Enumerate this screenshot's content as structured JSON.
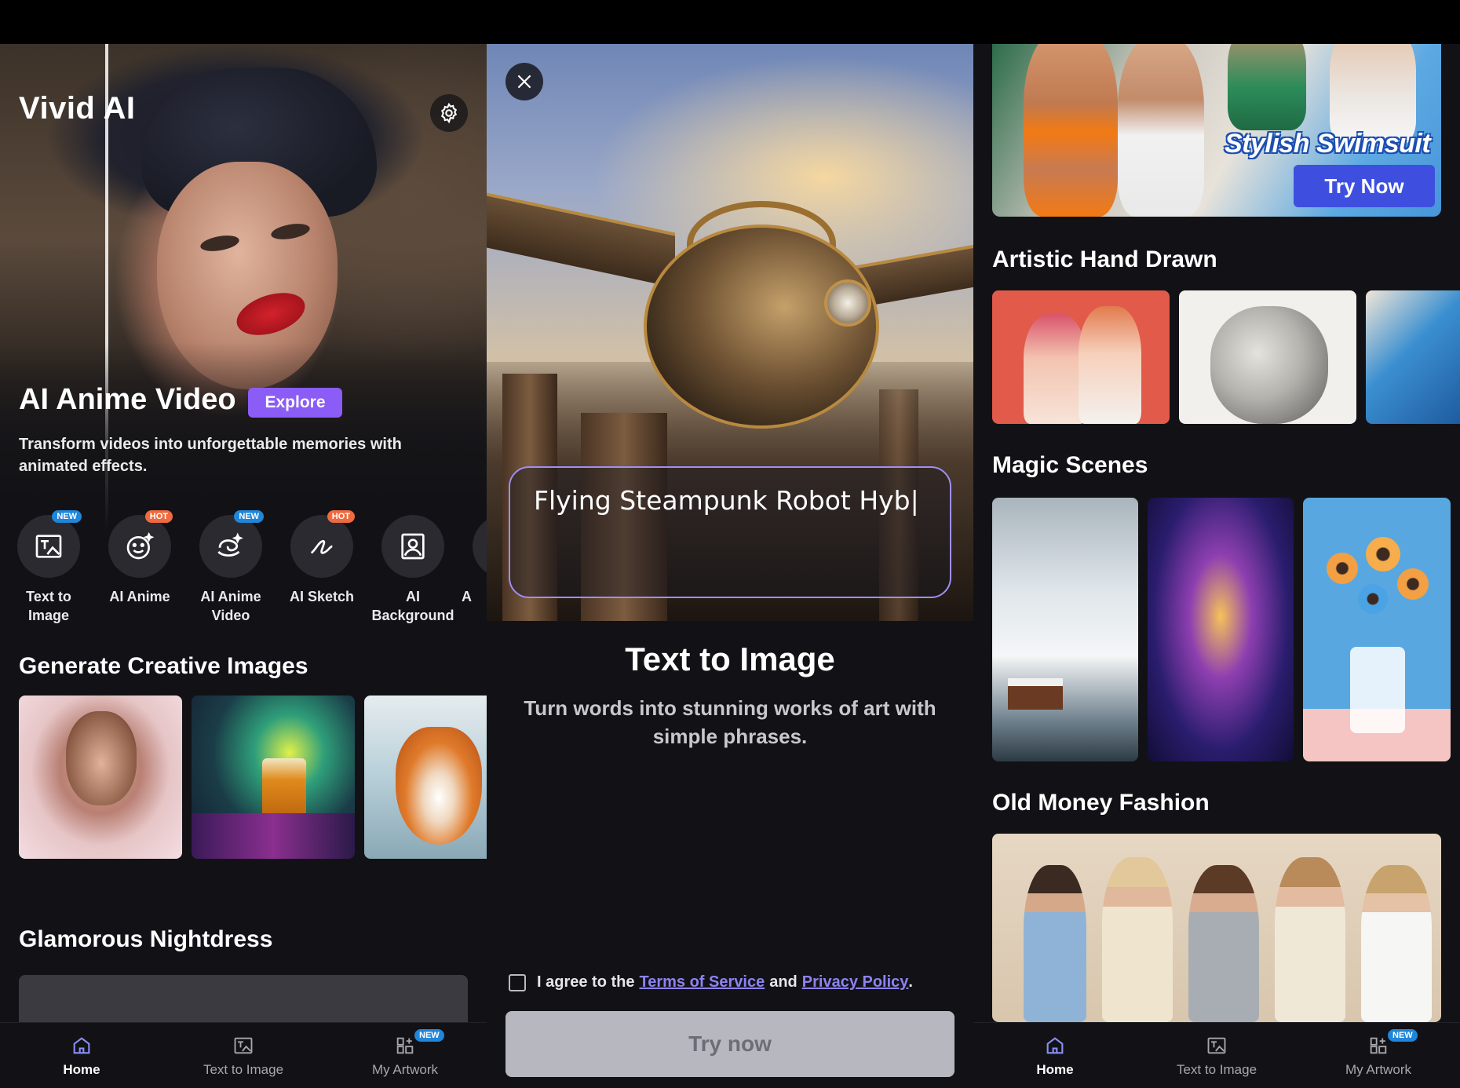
{
  "left": {
    "app_title": "Vivid AI",
    "hero": {
      "title": "AI Anime Video",
      "explore": "Explore",
      "description": "Transform videos into unforgettable memories with animated effects."
    },
    "tools": [
      {
        "label": "Text to\nImage",
        "badge": "NEW",
        "icon": "text-image-icon"
      },
      {
        "label": "AI Anime",
        "badge": "HOT",
        "icon": "smile-face-icon"
      },
      {
        "label": "AI Anime\nVideo",
        "badge": "NEW",
        "icon": "swirl-icon"
      },
      {
        "label": "AI Sketch",
        "badge": "HOT",
        "icon": "squiggle-icon"
      },
      {
        "label": "AI\nBackground",
        "badge": "",
        "icon": "portrait-frame-icon"
      },
      {
        "label": "A",
        "badge": "",
        "icon": "partial-icon"
      }
    ],
    "section_generate": "Generate Creative Images",
    "section_nightdress": "Glamorous Nightdress"
  },
  "middle": {
    "prompt_text": "Flying Steampunk Robot Hyb|",
    "title": "Text to Image",
    "description": "Turn words into stunning works of art with simple phrases.",
    "agree_prefix": "I agree to the",
    "terms": "Terms of Service",
    "and": "and",
    "privacy": "Privacy Policy",
    "period": ".",
    "try_button": "Try now"
  },
  "right": {
    "banner": {
      "title": "Stylish Swimsuit",
      "button": "Try Now"
    },
    "section_artistic": "Artistic Hand Drawn",
    "section_magic": "Magic Scenes",
    "section_old_money": "Old Money Fashion"
  },
  "nav": {
    "home": "Home",
    "text_to_image": "Text to Image",
    "my_artwork": "My Artwork",
    "new_badge": "NEW"
  },
  "colors": {
    "background": "#121216",
    "accent_purple": "#8b5cf6",
    "badge_new": "#1f86d9",
    "badge_hot": "#ef6a3f",
    "link": "#8c83f2",
    "button_disabled": "#b7b7c0",
    "try_now_blue": "#3e4fe0"
  }
}
